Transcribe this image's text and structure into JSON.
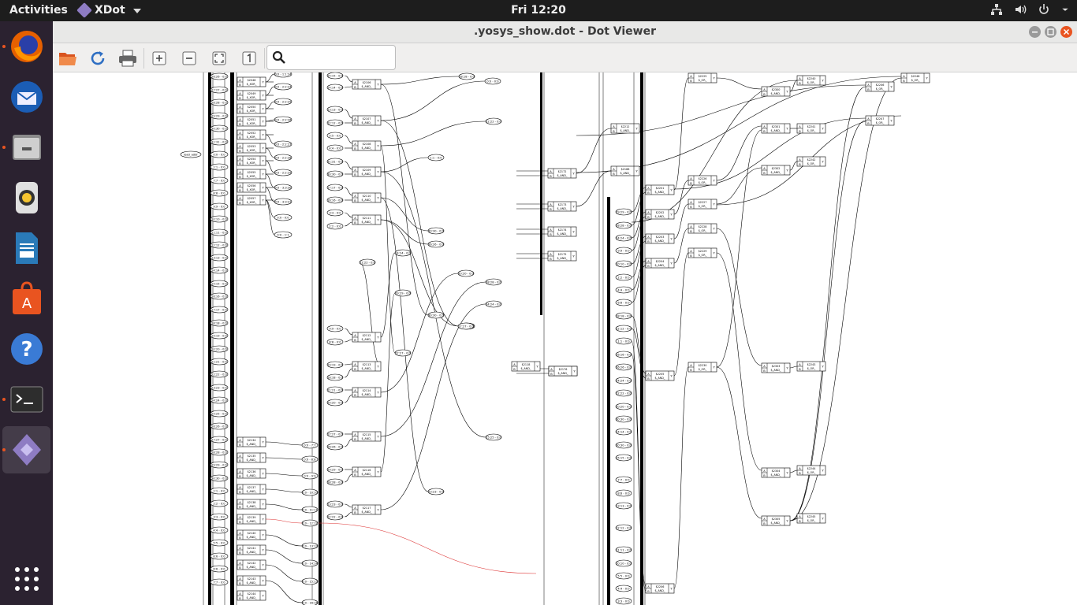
{
  "topbar": {
    "activities": "Activities",
    "app_name": "XDot",
    "clock": "Fri 12:20"
  },
  "window": {
    "title": ".yosys_show.dot - Dot Viewer"
  },
  "toolbar": {
    "search_placeholder": ""
  },
  "dock": {
    "apps": [
      "Firefox",
      "Thunderbird",
      "Files",
      "Rhythmbox",
      "LibreOffice Writer",
      "Ubuntu Software",
      "Help",
      "Terminal",
      "XDot",
      "Show Applications"
    ]
  },
  "graph": {
    "input_label": "load_addr",
    "left_column": [
      "26:26 - 0:0",
      "27:27 - 0:0",
      "28:28 - 0:0",
      "29:29 - 0:0",
      "30:30 - 0:0",
      "31:31 - 0:0",
      "0:0 - 0:0",
      "1:1 - 0:0",
      "7:7 - 0:0",
      "8:8 - 0:0",
      "9:9 - 0:0",
      "10:10 - 0:0",
      "11:11 - 0:0",
      "12:12 - 0:0",
      "13:13 - 0:0",
      "14:14 - 0:0",
      "15:15 - 0:0",
      "16:16 - 0:0",
      "17:17 - 0:0",
      "18:18 - 0:0",
      "19:19 - 0:0",
      "20:20 - 0:0",
      "21:21 - 0:0",
      "22:22 - 0:0",
      "23:23 - 0:0",
      "24:24 - 0:0",
      "25:25 - 0:0",
      "26:26 - 0:0",
      "27:27 - 0:0",
      "28:28 - 0:0",
      "29:29 - 0:0",
      "30:30 - 0:0",
      "1:1 - 0:0",
      "2:2 - 0:0",
      "3:3 - 0:0",
      "4:4 - 0:0",
      "5:5 - 0:0",
      "6:6 - 0:0",
      "6:6 - 0:0",
      "7:7 - 0:0"
    ],
    "xor_cells": [
      "$2048",
      "$2049",
      "$2050",
      "$2051",
      "$2052",
      "$2053",
      "$2054",
      "$2055",
      "$2056",
      "$2057"
    ],
    "xor_type": "$_XOR_",
    "and_type": "$_AND_",
    "or_type": "$_OR_",
    "left_and_cells": [
      "$2134",
      "$2135",
      "$2136",
      "$2137",
      "$2138",
      "$2139",
      "$2140",
      "$2141",
      "$2142",
      "$2143",
      "$2144"
    ],
    "slice_labels": [
      "0:0 - 1:1:24",
      "0:0 - 2:2:24",
      "0:0 - 2:2:25",
      "0:0 - 2:2:26",
      "0:0 - 2:2:27",
      "0:0 - 2:2:28",
      "0:0 - 2:2:29",
      "0:0 - 3:3:30",
      "0:0 - 3:3:31",
      "0:0 - 0:0",
      "0:0 - 1:1"
    ],
    "mid_slice_labels": [
      "0:0 - 7:7",
      "0:0 - 8:8",
      "0:0 - 9:9",
      "0:0 - 10:10",
      "0:0 - 11:11",
      "0:0 - 12:12",
      "0:0 - 13:13",
      "0:0 - 14:14",
      "0:0 - 15:15",
      "0:0 - 16:16"
    ],
    "col3_labels": [
      "15:15 - 0:0",
      "14:14 - 0:0",
      "13:13 - 0:0",
      "12:12 - 0:0",
      "5:5 - 0:0",
      "4:4 - 0:0",
      "31:31 - 0:0",
      "30:30 - 0:0",
      "17:17 - 0:0",
      "16:16 - 0:0",
      "3:3 - 0:0",
      "2:2 - 0:0",
      "9:9 - 0:0",
      "8:8 - 0:0",
      "19:19 - 0:0",
      "18:18 - 0:0",
      "21:21 - 0:0",
      "20:20 - 0:0",
      "27:27 - 0:0",
      "26:26 - 0:0",
      "29:29 - 0:0",
      "28:28 - 0:0",
      "23:23 - 0:0",
      "22:22 - 0:0"
    ],
    "float_labels": [
      "18:18 - 0:0",
      "0:0 - 0:0",
      "22:22 - 0:0",
      "1:1 - 0:0",
      "30:30 - 0:0",
      "26:26 - 0:0",
      "24:24 - 0:0",
      "22:22 - 0:0",
      "20:20 - 0:0",
      "28:28 - 0:0",
      "29:29 - 0:0",
      "24:24 - 0:0",
      "30:30 - 0:0",
      "0:0 - 0:0",
      "27:27 - 0:0",
      "25:25 - 0:0",
      "23:23 - 0:0",
      "27:27 - 0:0"
    ],
    "right_labels": [
      "29:29 - 0:0",
      "28:28 - 0:0",
      "24:24 - 0:0",
      "9:9 - 0:0",
      "10:10 - 0:0",
      "2:2 - 0:0",
      "4:4 - 0:0",
      "6:6 - 0:0",
      "18:18 - 0:0",
      "12:12 - 0:0",
      "1:1 - 0:0",
      "16:16 - 0:0",
      "26:26 - 0:0",
      "24:24 - 0:0",
      "22:22 - 0:0",
      "20:20 - 0:0",
      "30:30 - 0:0",
      "14:14 - 0:0",
      "30:30 - 0:0",
      "15:15 - 0:0",
      "7:7 - 0:0",
      "8:8 - 0:0",
      "13:13 - 0:0",
      "12:12 - 0:0",
      "11:11 - 0:0",
      "10:10 - 0:0",
      "5:5 - 0:0",
      "4:4 - 0:0",
      "3:3 - 0:0"
    ],
    "mid_and_cells": [
      "$2106",
      "$2107",
      "$2108",
      "$2109",
      "$2110",
      "$2111",
      "$2112",
      "$2113",
      "$2114",
      "$2115",
      "$2116",
      "$2117",
      "$2118",
      "$2119",
      "$2120",
      "$2121"
    ],
    "col5_cells": [
      "$2172",
      "$2173",
      "$2174",
      "$2175",
      "$2176"
    ],
    "col6_cells": [
      "$2212",
      "$2188"
    ],
    "col7_and_cells": [
      "$2201",
      "$2202",
      "$2203",
      "$2204",
      "$2205",
      "$2206",
      "$2207"
    ],
    "or_cells": [
      "$2225",
      "$2226",
      "$2227",
      "$2228",
      "$2229",
      "$2230"
    ],
    "right_and_cells": [
      "$2300",
      "$2301",
      "$2302",
      "$2303",
      "$2304",
      "$2305",
      "$2306"
    ],
    "right_or_cells": [
      "$2240",
      "$2241",
      "$2242",
      "$2243",
      "$2244",
      "$2245",
      "$2246",
      "$2247",
      "$2248"
    ]
  }
}
